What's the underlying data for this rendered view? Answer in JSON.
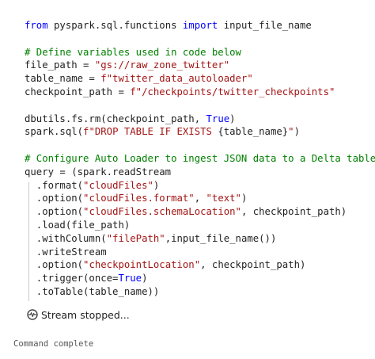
{
  "colors": {
    "keyword": "#0000ff",
    "string": "#a31515",
    "comment": "#008000",
    "text": "#1f1f1f",
    "status_text": "#222222",
    "footer_text": "#555555"
  },
  "code_lines": [
    [
      {
        "t": "from",
        "k": "kw"
      },
      {
        "t": " pyspark.sql.functions ",
        "k": "default"
      },
      {
        "t": "import",
        "k": "kw"
      },
      {
        "t": " input_file_name",
        "k": "default"
      }
    ],
    [],
    [
      {
        "t": "# Define variables used in code below",
        "k": "comment"
      }
    ],
    [
      {
        "t": "file_path = ",
        "k": "default"
      },
      {
        "t": "\"gs://raw_zone_twitter\"",
        "k": "str"
      }
    ],
    [
      {
        "t": "table_name = ",
        "k": "default"
      },
      {
        "t": "f\"twitter_data_autoloader\"",
        "k": "str"
      }
    ],
    [
      {
        "t": "checkpoint_path = ",
        "k": "default"
      },
      {
        "t": "f\"/checkpoints/twitter_checkpoints\"",
        "k": "str"
      }
    ],
    [],
    [
      {
        "t": "dbutils.fs.rm(checkpoint_path, ",
        "k": "default"
      },
      {
        "t": "True",
        "k": "bool"
      },
      {
        "t": ")",
        "k": "default"
      }
    ],
    [
      {
        "t": "spark.sql(",
        "k": "default"
      },
      {
        "t": "f\"DROP TABLE IF EXISTS ",
        "k": "str"
      },
      {
        "t": "{table_name}",
        "k": "default"
      },
      {
        "t": "\"",
        "k": "str"
      },
      {
        "t": ")",
        "k": "default"
      }
    ],
    [],
    [
      {
        "t": "# Configure Auto Loader to ingest JSON data to a Delta table",
        "k": "comment"
      }
    ],
    [
      {
        "t": "query = (spark.readStream",
        "k": "default"
      }
    ],
    [
      {
        "t": "  .format(",
        "k": "default"
      },
      {
        "t": "\"cloudFiles\"",
        "k": "str"
      },
      {
        "t": ")",
        "k": "default"
      }
    ],
    [
      {
        "t": "  .option(",
        "k": "default"
      },
      {
        "t": "\"cloudFiles.format\"",
        "k": "str"
      },
      {
        "t": ", ",
        "k": "default"
      },
      {
        "t": "\"text\"",
        "k": "str"
      },
      {
        "t": ")",
        "k": "default"
      }
    ],
    [
      {
        "t": "  .option(",
        "k": "default"
      },
      {
        "t": "\"cloudFiles.schemaLocation\"",
        "k": "str"
      },
      {
        "t": ", checkpoint_path)",
        "k": "default"
      }
    ],
    [
      {
        "t": "  .load(file_path)",
        "k": "default"
      }
    ],
    [
      {
        "t": "  .withColumn(",
        "k": "default"
      },
      {
        "t": "\"filePath\"",
        "k": "str"
      },
      {
        "t": ",input_file_name())",
        "k": "default"
      }
    ],
    [
      {
        "t": "  .writeStream",
        "k": "default"
      }
    ],
    [
      {
        "t": "  .option(",
        "k": "default"
      },
      {
        "t": "\"checkpointLocation\"",
        "k": "str"
      },
      {
        "t": ", checkpoint_path)",
        "k": "default"
      }
    ],
    [
      {
        "t": "  .trigger(once=",
        "k": "default"
      },
      {
        "t": "True",
        "k": "bool"
      },
      {
        "t": ")",
        "k": "default"
      }
    ],
    [
      {
        "t": "  .toTable(table_name))",
        "k": "default"
      }
    ]
  ],
  "status": {
    "icon": "stream-stopped-icon",
    "text": "Stream stopped..."
  },
  "footer": {
    "text": "Command complete"
  }
}
